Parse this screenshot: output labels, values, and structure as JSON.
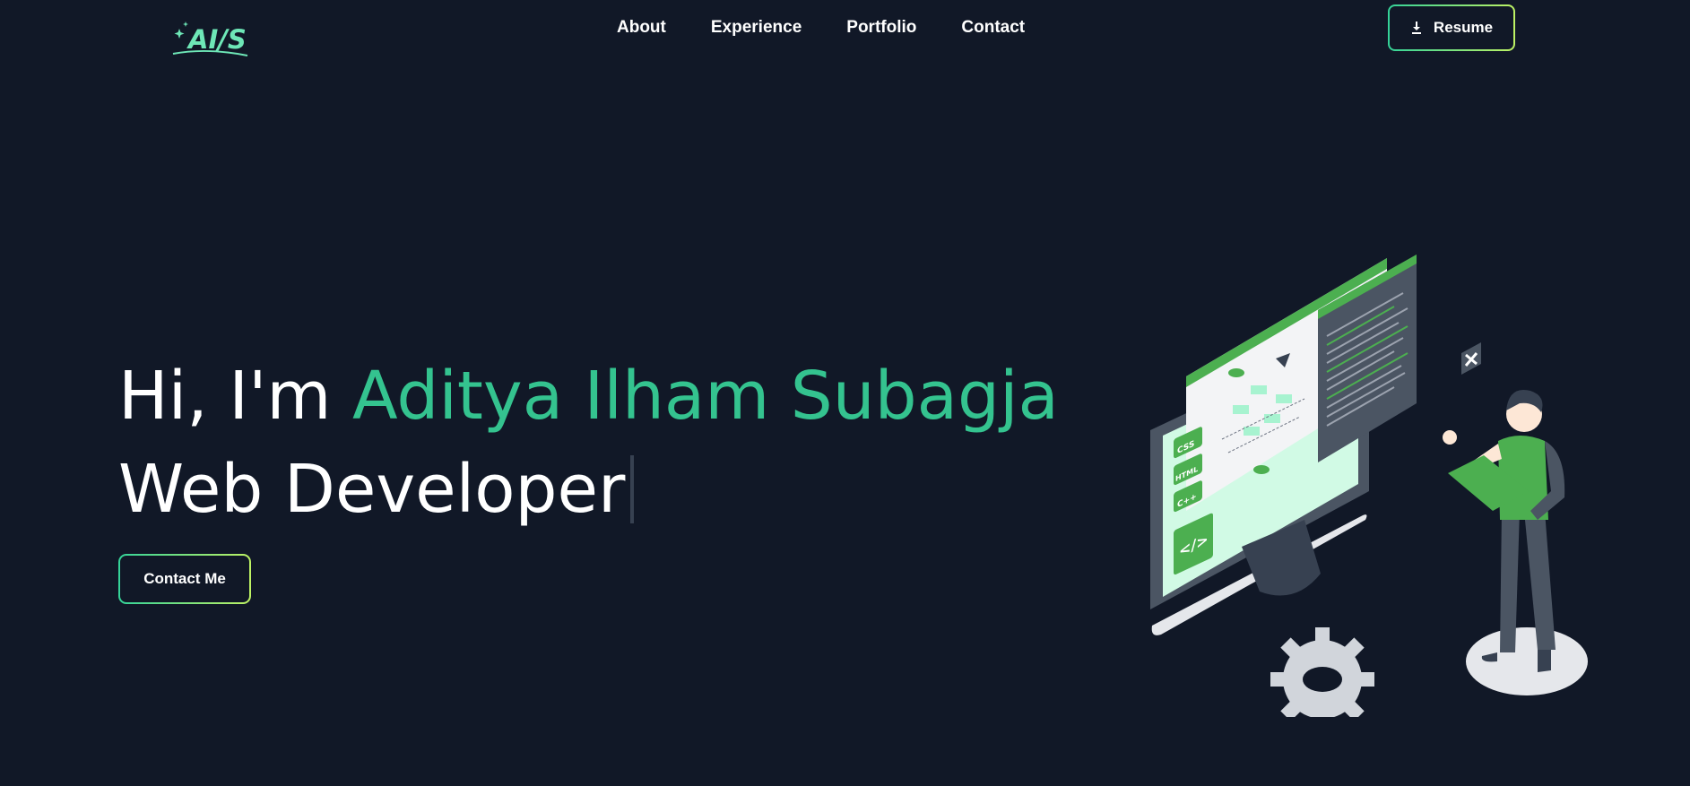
{
  "header": {
    "logo_text": "AI/S",
    "nav": [
      {
        "label": "About"
      },
      {
        "label": "Experience"
      },
      {
        "label": "Portfolio"
      },
      {
        "label": "Contact"
      }
    ],
    "resume_label": "Resume",
    "resume_icon": "download-icon"
  },
  "hero": {
    "greeting": "Hi, I'm ",
    "name": "Aditya Ilham Subagja",
    "role": "Web Developer",
    "contact_label": "Contact Me"
  },
  "illustration": {
    "badges": [
      "CSS",
      "HTML",
      "C++"
    ],
    "code_symbol": "</>"
  },
  "colors": {
    "background": "#111827",
    "accent": "#34c38f",
    "gradient_from": "#34d399",
    "gradient_to": "#bef264"
  }
}
